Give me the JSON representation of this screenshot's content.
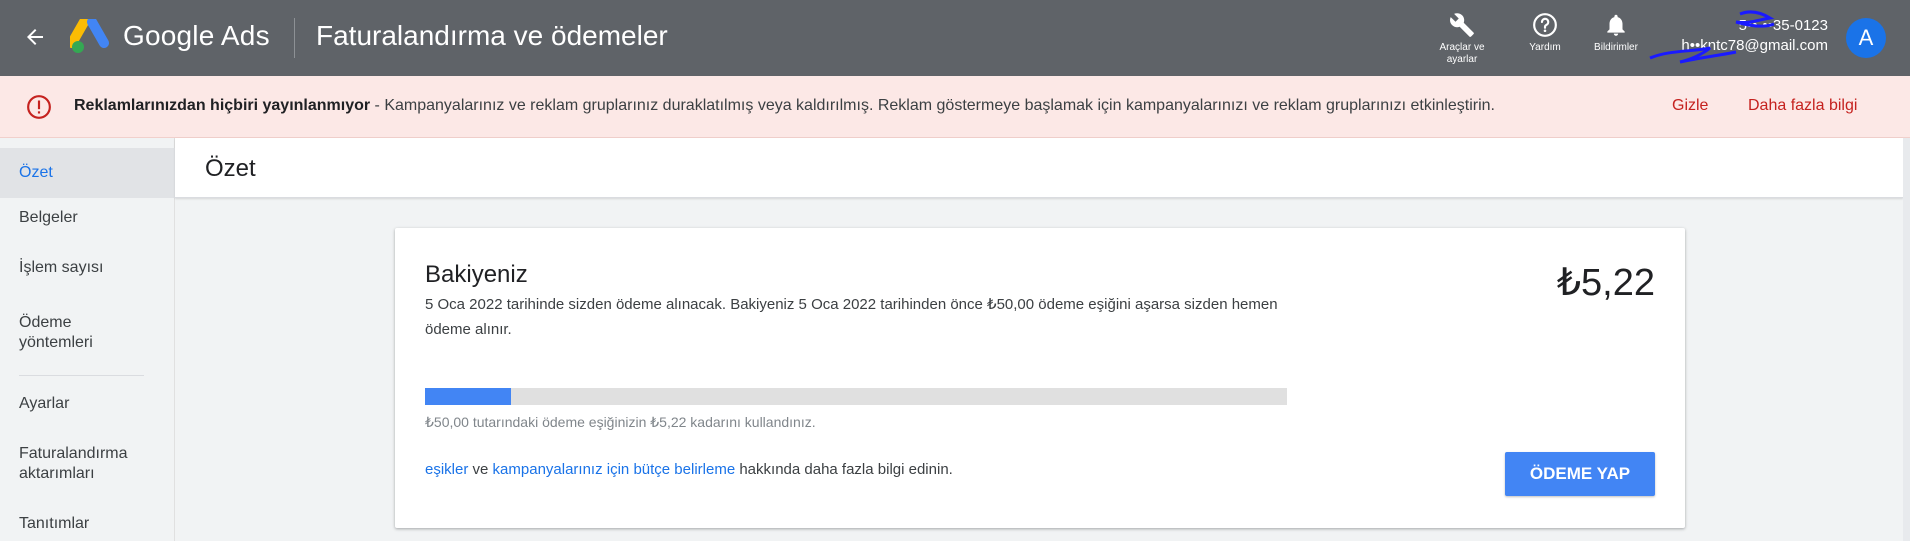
{
  "header": {
    "brand": "Google Ads",
    "page_title": "Faturalandırma ve ödemeler",
    "tools_label": "Araçlar ve ayarlar",
    "help_label": "Yardım",
    "notifications_label": "Bildirimler",
    "account_id": "5••-••35-0123",
    "account_email": "h••kntc78@gmail.com",
    "avatar_letter": "A"
  },
  "alert": {
    "title": "Reklamlarınızdan hiçbiri yayınlanmıyor",
    "message": " - Kampanyalarınız ve reklam gruplarınız duraklatılmış veya kaldırılmış. Reklam göstermeye başlamak için kampanyalarınızı ve reklam gruplarınızı etkinleştirin.",
    "hide_label": "Gizle",
    "more_label": "Daha fazla bilgi"
  },
  "sidebar": {
    "items": [
      {
        "label": "Özet",
        "active": true
      },
      {
        "label": "Belgeler"
      },
      {
        "label": "İşlem sayısı"
      },
      {
        "label": "Ödeme yöntemleri"
      },
      {
        "label": "Ayarlar"
      },
      {
        "label": "Faturalandırma aktarımları"
      },
      {
        "label": "Tanıtımlar"
      }
    ]
  },
  "main": {
    "title": "Özet",
    "balance": {
      "title": "Bakiyeniz",
      "description": "5 Oca 2022 tarihinde sizden ödeme alınacak. Bakiyeniz 5 Oca 2022 tarihinden önce ₺50,00 ödeme eşiğini aşarsa sizden hemen ödeme alınır.",
      "amount": "₺5,22",
      "progress_fraction": 0.1,
      "progress_note": "₺50,00 tutarındaki ödeme eşiğinizin ₺5,22 kadarını kullandınız.",
      "link_thresholds": "eşikler",
      "link_conj": " ve ",
      "link_budget": "kampanyalarınız için bütçe belirleme",
      "link_suffix": " hakkında daha fazla bilgi edinin.",
      "pay_button": "ÖDEME YAP"
    }
  },
  "colors": {
    "topbar": "#5f6368",
    "alert_bg": "#fce8e6",
    "alert_accent": "#c5221f",
    "primary": "#4285f4",
    "link": "#1a73e8"
  },
  "icons": [
    "back-arrow-icon",
    "google-ads-logo",
    "wrench-icon",
    "help-icon",
    "bell-icon",
    "error-icon"
  ]
}
